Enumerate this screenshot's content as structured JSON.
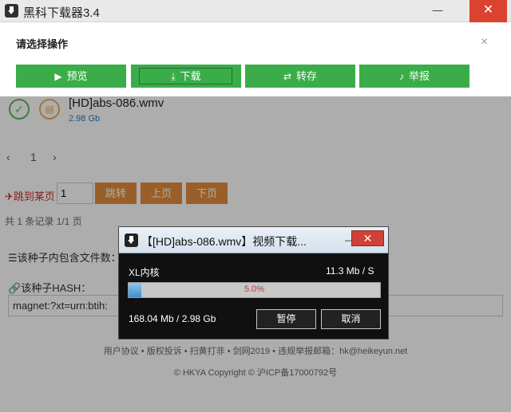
{
  "window": {
    "title": "黑科下载器3.4",
    "minimize": "—",
    "maximize": "□",
    "close": "✕"
  },
  "panel": {
    "title": "请选择操作",
    "close": "×",
    "buttons": [
      {
        "label": "预览",
        "icon": "play-circle-icon"
      },
      {
        "label": "下载",
        "icon": "download-icon"
      },
      {
        "label": "转存",
        "icon": "transfer-icon"
      },
      {
        "label": "举报",
        "icon": "bell-icon"
      }
    ]
  },
  "file": {
    "name": "[HD]abs-086.wmv",
    "size": "2.98 Gb"
  },
  "pager": {
    "prev": "‹",
    "current": "1",
    "next": "›",
    "jump_label": "跳到某页",
    "jump_value": "1",
    "jump_btn": "跳转",
    "prev_btn": "上页",
    "next_btn": "下页",
    "records": "共 1 条记录 1/1 页"
  },
  "torrent": {
    "files_label": "该种子内包含文件数：",
    "hash_label": "该种子HASH：",
    "magnet": "magnet:?xt=urn:btih:"
  },
  "footer": {
    "links": "用户协议 • 版权投诉 • 扫黄打非 • 剑网2019 • 违规举报邮箱：hk@heikeyun.net",
    "copyright": "© HKYA Copyright © 沪ICP备17000792号"
  },
  "dialog": {
    "title": "【[HD]abs-086.wmv】视频下载...",
    "minimize": "—",
    "close": "✕",
    "core": "XL内核",
    "speed": "11.3 Mb / S",
    "progress": 5.0,
    "progress_text": "5.0%",
    "size": "168.04 Mb / 2.98 Gb",
    "pause": "暂停",
    "cancel": "取消"
  },
  "colors": {
    "green": "#3aad48",
    "orange": "#e38d3c",
    "close_red": "#d9432f",
    "dialog_bg": "#101010",
    "progress_fill": "#3d8fd0"
  }
}
